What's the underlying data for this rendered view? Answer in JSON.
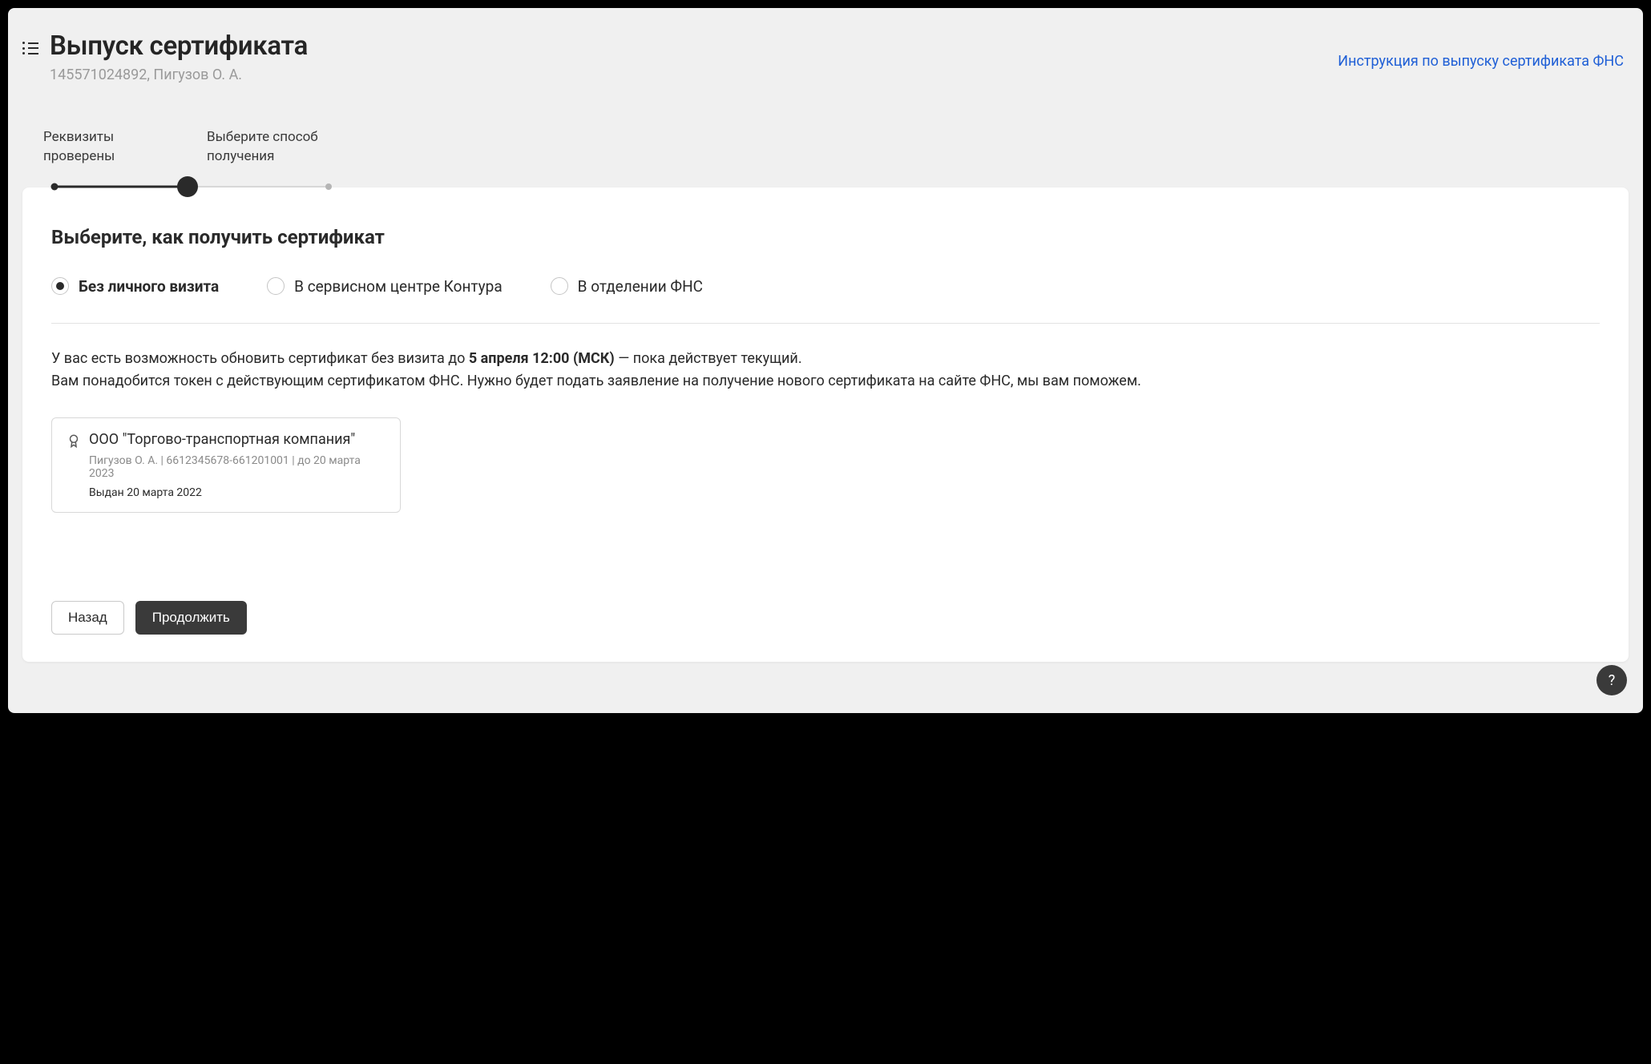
{
  "header": {
    "title": "Выпуск сертификата",
    "subtitle": "145571024892, Пигузов О. А.",
    "instruction_link": "Инструкция по выпуску сертификата ФНС"
  },
  "stepper": {
    "steps": [
      {
        "label": "Реквизиты проверены"
      },
      {
        "label": "Выберите способ получения"
      }
    ]
  },
  "card": {
    "title": "Выберите, как получить сертификат",
    "radio_options": [
      {
        "label": "Без личного визита",
        "selected": true
      },
      {
        "label": "В сервисном центре Контура",
        "selected": false
      },
      {
        "label": "В отделении ФНС",
        "selected": false
      }
    ],
    "info": {
      "prefix": "У вас есть возможность обновить сертификат без визита до ",
      "bold_date": "5 апреля 12:00 (МСК)",
      "after_date": " — пока действует текущий.",
      "line2": "Вам понадобится токен с действующим сертификатом ФНС.  Нужно будет подать заявление на получение нового сертификата на сайте ФНС, мы вам поможем."
    },
    "certificate": {
      "company": "ООО \"Торгово-транспортная компания\"",
      "meta": "Пигузов О. А. | 6612345678-661201001 | до 20 марта 2023",
      "issued": "Выдан 20 марта 2022"
    }
  },
  "buttons": {
    "back": "Назад",
    "continue": "Продолжить"
  },
  "help_label": "?"
}
